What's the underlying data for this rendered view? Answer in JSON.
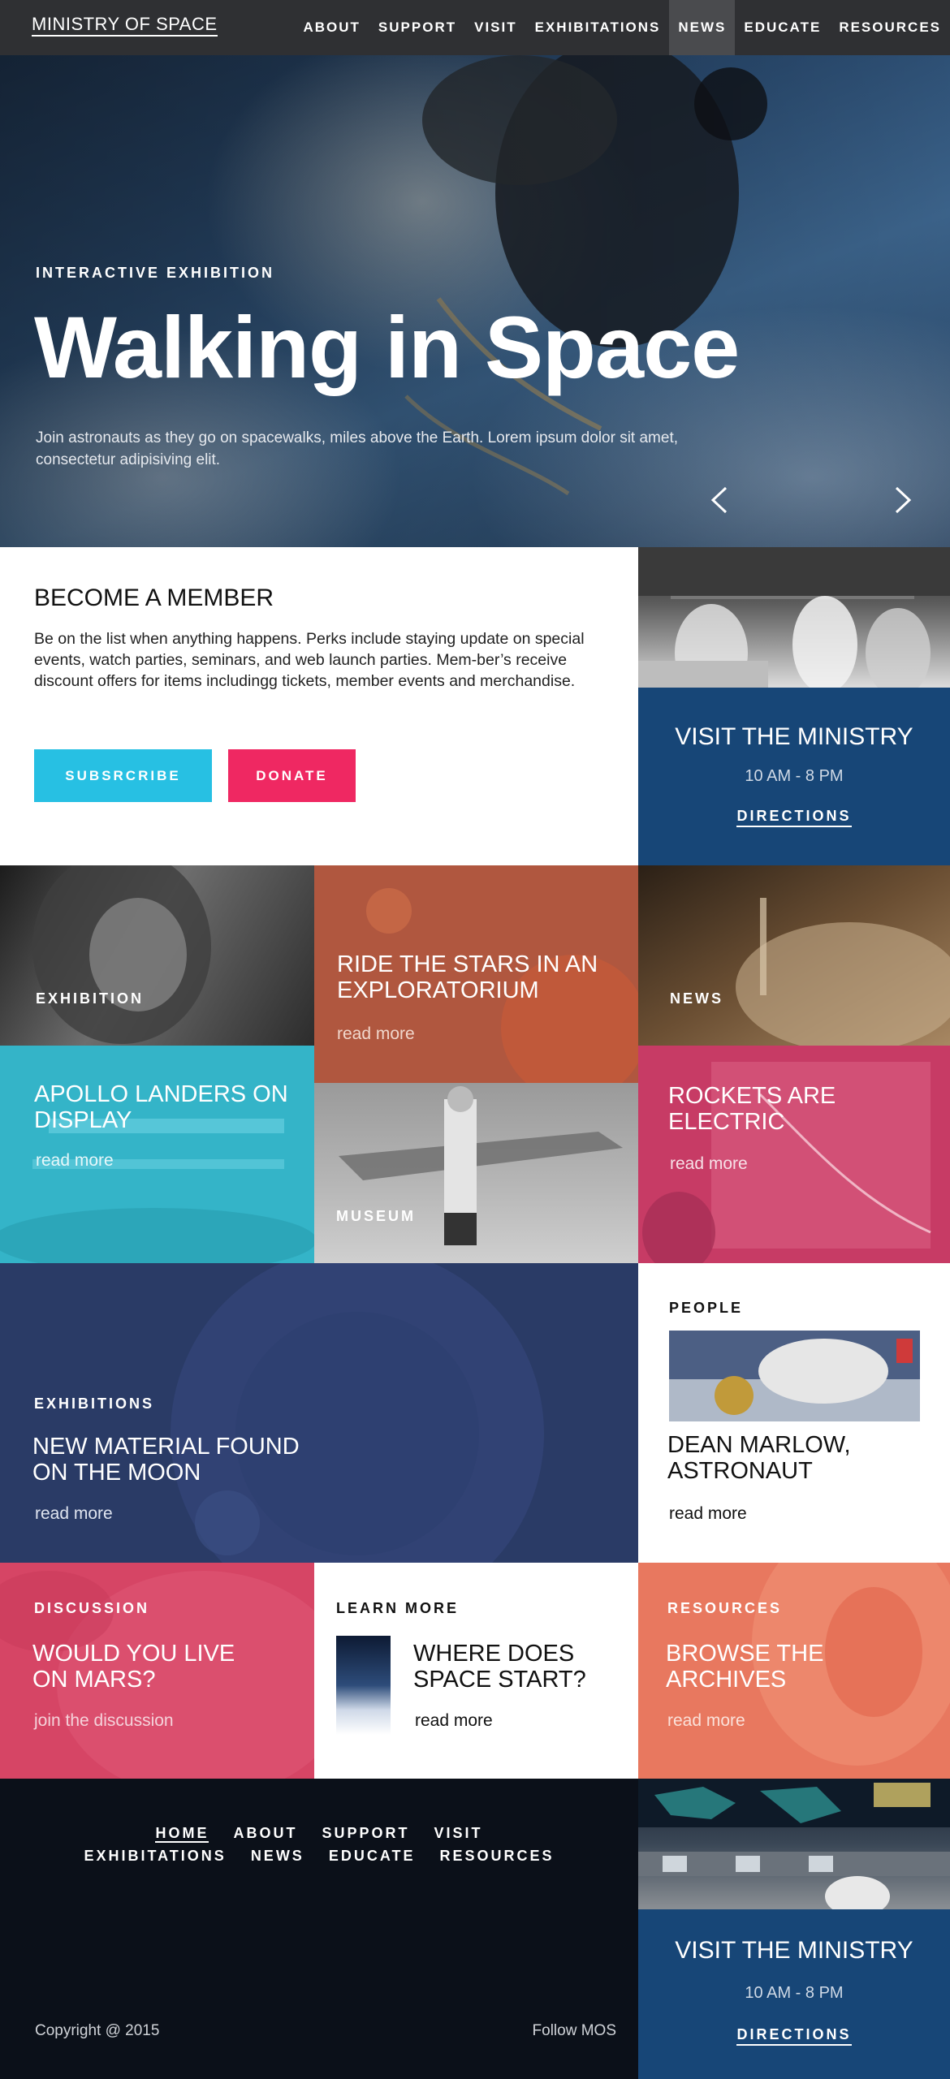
{
  "nav": {
    "logo": "MINISTRY OF SPACE",
    "links": [
      "ABOUT",
      "SUPPORT",
      "VISIT",
      "EXHIBITATIONS",
      "NEWS",
      "EDUCATE",
      "RESOURCES"
    ],
    "active": "NEWS"
  },
  "hero": {
    "tag": "INTERACTIVE EXHIBITION",
    "title": "Walking in Space",
    "description": "Join astronauts as they go on spacewalks, miles above the Earth. Lorem ipsum dolor sit amet, consectetur adipisiving elit.",
    "prev_icon": "chevron-left-icon",
    "next_icon": "chevron-right-icon"
  },
  "member": {
    "title": "BECOME A MEMBER",
    "body": "Be on the list when anything happens. Perks include staying update on special events, watch parties, seminars, and web launch parties. Mem-ber’s receive discount offers for items includingg tickets, member events and merchandise.",
    "subscribe_label": "SUBSRCRIBE",
    "donate_label": "DONATE"
  },
  "visit": {
    "title": "VISIT THE MINISTRY",
    "hours": "10 AM - 8 PM",
    "directions": "DIRECTIONS"
  },
  "tiles": {
    "exhibition": {
      "label": "EXHIBITION"
    },
    "ride": {
      "title": "RIDE THE STARS IN AN EXPLORATORIUM",
      "more": "read more"
    },
    "news": {
      "label": "NEWS"
    },
    "apollo": {
      "title": "APOLLO LANDERS ON DISPLAY",
      "more": "read more"
    },
    "museum": {
      "label": "MUSEUM"
    },
    "rockets": {
      "title": "ROCKETS ARE ELECTRIC",
      "more": "read more"
    },
    "exhibitions": {
      "label": "EXHIBITIONS",
      "title": "NEW MATERIAL FOUND ON THE MOON",
      "more": "read more"
    },
    "people": {
      "label": "PEOPLE",
      "title": "DEAN MARLOW, ASTRONAUT",
      "more": "read more"
    },
    "discussion": {
      "label": "DISCUSSION",
      "title": "WOULD YOU LIVE ON MARS?",
      "more": "join the discussion"
    },
    "learn": {
      "label": "LEARN MORE",
      "title": "WHERE DOES SPACE START?",
      "more": "read more"
    },
    "resources": {
      "label": "RESOURCES",
      "title": "BROWSE THE ARCHIVES",
      "more": "read more"
    }
  },
  "footer": {
    "links_row1": [
      "HOME",
      "ABOUT",
      "SUPPORT",
      "VISIT"
    ],
    "links_row2": [
      "EXHIBITATIONS",
      "NEWS",
      "EDUCATE",
      "RESOURCES"
    ],
    "copyright": "Copyright @ 2015",
    "follow": "Follow MOS"
  },
  "colors": {
    "nav_bg": "#2f3033",
    "subscribe": "#27c0e3",
    "donate": "#ef2862",
    "visit_blue": "#174677",
    "footer_bg": "#0b1019"
  }
}
